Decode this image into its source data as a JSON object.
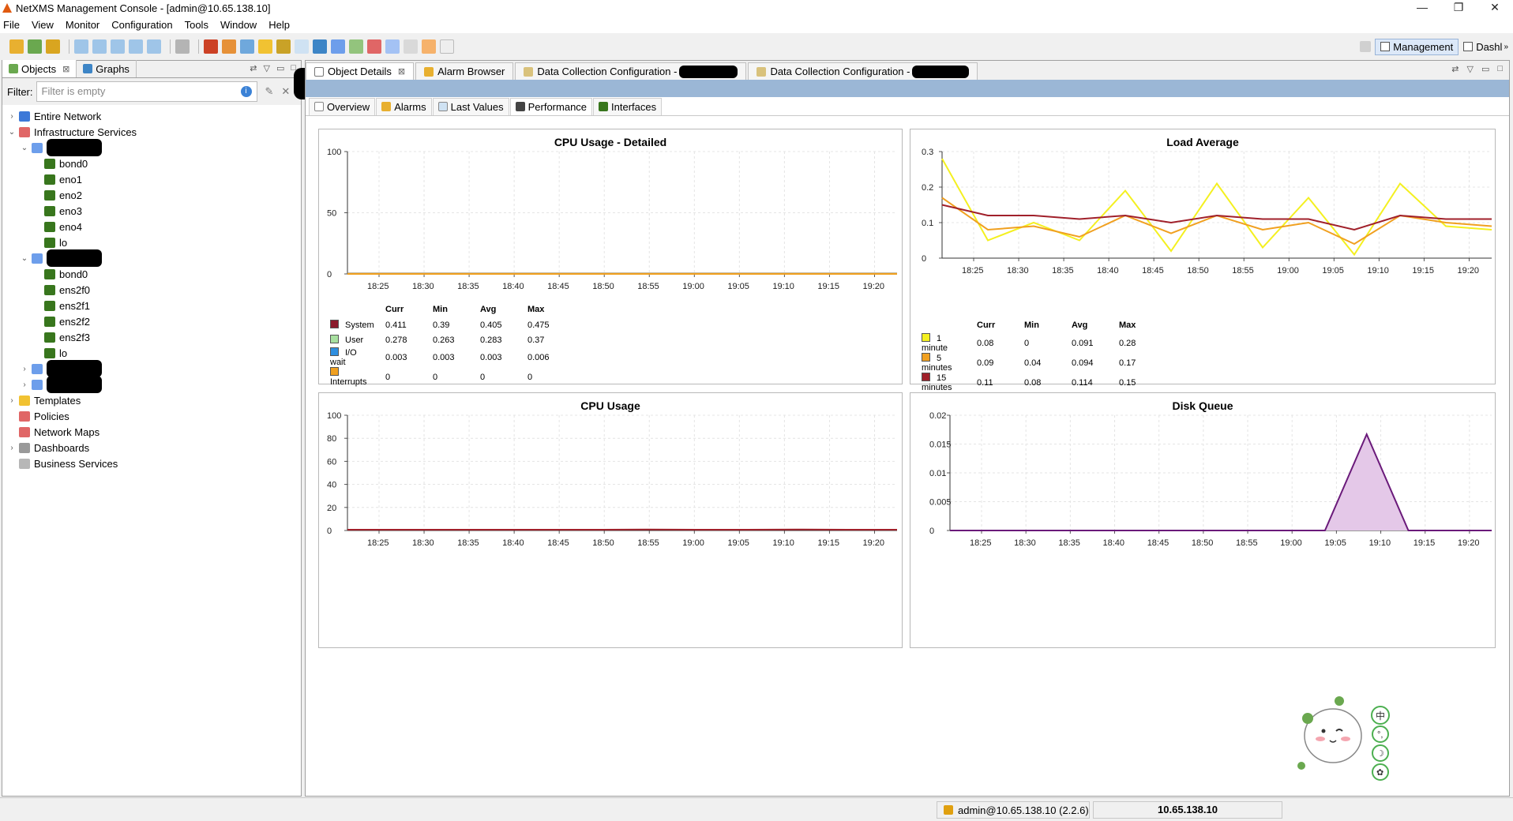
{
  "window": {
    "title": "NetXMS Management Console - [admin@10.65.138.10]",
    "controls": [
      "—",
      "❐",
      "✕"
    ]
  },
  "menu": [
    "File",
    "View",
    "Monitor",
    "Configuration",
    "Tools",
    "Window",
    "Help"
  ],
  "perspectives": [
    "Management",
    "Dashl"
  ],
  "left_panel": {
    "tabs": [
      "Objects",
      "Graphs"
    ],
    "filter_label": "Filter:",
    "filter_placeholder": "Filter is empty",
    "tree": [
      {
        "label": "Entire Network",
        "level": 0,
        "twisty": "›"
      },
      {
        "label": "Infrastructure Services",
        "level": 0,
        "twisty": "⌄"
      },
      {
        "label": "",
        "level": 1,
        "twisty": "⌄",
        "redacted": true
      },
      {
        "label": "bond0",
        "level": 2
      },
      {
        "label": "eno1",
        "level": 2
      },
      {
        "label": "eno2",
        "level": 2
      },
      {
        "label": "eno3",
        "level": 2
      },
      {
        "label": "eno4",
        "level": 2
      },
      {
        "label": "lo",
        "level": 2
      },
      {
        "label": "",
        "level": 1,
        "twisty": "⌄",
        "redacted": true
      },
      {
        "label": "bond0",
        "level": 2
      },
      {
        "label": "ens2f0",
        "level": 2
      },
      {
        "label": "ens2f1",
        "level": 2
      },
      {
        "label": "ens2f2",
        "level": 2
      },
      {
        "label": "ens2f3",
        "level": 2
      },
      {
        "label": "lo",
        "level": 2
      },
      {
        "label": "",
        "level": 1,
        "twisty": "›",
        "redacted": true
      },
      {
        "label": "",
        "level": 1,
        "twisty": "›",
        "redacted": true
      },
      {
        "label": "Templates",
        "level": 0,
        "twisty": "›"
      },
      {
        "label": "Policies",
        "level": 0
      },
      {
        "label": "Network Maps",
        "level": 0
      },
      {
        "label": "Dashboards",
        "level": 0,
        "twisty": "›"
      },
      {
        "label": "Business Services",
        "level": 0
      }
    ]
  },
  "editor_tabs": [
    "Object Details",
    "Alarm Browser",
    "Data Collection Configuration -",
    "Data Collection Configuration -"
  ],
  "sub_tabs": [
    "Overview",
    "Alarms",
    "Last Values",
    "Performance",
    "Interfaces"
  ],
  "time_ticks": [
    "18:25",
    "18:30",
    "18:35",
    "18:40",
    "18:45",
    "18:50",
    "18:55",
    "19:00",
    "19:05",
    "19:10",
    "19:15",
    "19:20"
  ],
  "legend_headers": [
    "Curr",
    "Min",
    "Avg",
    "Max"
  ],
  "charts": {
    "cpu_detailed": {
      "title": "CPU Usage - Detailed",
      "y_ticks": [
        "100",
        "50",
        "0"
      ],
      "legend": [
        {
          "name": "System",
          "color": "#8b1a2b",
          "curr": "0.411",
          "min": "0.39",
          "avg": "0.405",
          "max": "0.475"
        },
        {
          "name": "User",
          "color": "#a8e0a0",
          "curr": "0.278",
          "min": "0.263",
          "avg": "0.283",
          "max": "0.37"
        },
        {
          "name": "I/O wait",
          "color": "#2f8fe0",
          "curr": "0.003",
          "min": "0.003",
          "avg": "0.003",
          "max": "0.006"
        },
        {
          "name": "Interrupts",
          "color": "#f0a020",
          "curr": "0",
          "min": "0",
          "avg": "0",
          "max": "0"
        }
      ]
    },
    "load_average": {
      "title": "Load Average",
      "y_ticks": [
        "0.3",
        "0.2",
        "0.1",
        "0"
      ],
      "legend": [
        {
          "name": "1 minute",
          "color": "#f4f020",
          "curr": "0.08",
          "min": "0",
          "avg": "0.091",
          "max": "0.28"
        },
        {
          "name": "5 minutes",
          "color": "#f0a020",
          "curr": "0.09",
          "min": "0.04",
          "avg": "0.094",
          "max": "0.17"
        },
        {
          "name": "15 minutes",
          "color": "#a0202a",
          "curr": "0.11",
          "min": "0.08",
          "avg": "0.114",
          "max": "0.15"
        }
      ]
    },
    "cpu_usage": {
      "title": "CPU Usage",
      "y_ticks": [
        "100",
        "80",
        "60",
        "40",
        "20",
        "0"
      ]
    },
    "disk_queue": {
      "title": "Disk Queue",
      "y_ticks": [
        "0.02",
        "0.015",
        "0.01",
        "0.005",
        "0"
      ]
    }
  },
  "chart_data": [
    {
      "type": "line",
      "title": "CPU Usage - Detailed",
      "ylim": [
        0,
        100
      ],
      "x": [
        "18:25",
        "18:30",
        "18:35",
        "18:40",
        "18:45",
        "18:50",
        "18:55",
        "19:00",
        "19:05",
        "19:10",
        "19:15",
        "19:20"
      ],
      "series": [
        {
          "name": "System",
          "values": [
            0.41,
            0.41,
            0.4,
            0.41,
            0.4,
            0.41,
            0.4,
            0.41,
            0.41,
            0.4,
            0.41,
            0.41
          ]
        },
        {
          "name": "User",
          "values": [
            0.28,
            0.28,
            0.28,
            0.28,
            0.29,
            0.28,
            0.28,
            0.28,
            0.28,
            0.28,
            0.28,
            0.28
          ]
        },
        {
          "name": "I/O wait",
          "values": [
            0.003,
            0.003,
            0.003,
            0.003,
            0.003,
            0.003,
            0.003,
            0.003,
            0.003,
            0.003,
            0.003,
            0.003
          ]
        },
        {
          "name": "Interrupts",
          "values": [
            0,
            0,
            0,
            0,
            0,
            0,
            0,
            0,
            0,
            0,
            0,
            0
          ]
        }
      ]
    },
    {
      "type": "line",
      "title": "Load Average",
      "ylim": [
        0,
        0.3
      ],
      "x": [
        "18:25",
        "18:30",
        "18:35",
        "18:40",
        "18:45",
        "18:50",
        "18:55",
        "19:00",
        "19:05",
        "19:10",
        "19:15",
        "19:20"
      ],
      "series": [
        {
          "name": "1 minute",
          "values": [
            0.28,
            0.05,
            0.1,
            0.05,
            0.19,
            0.02,
            0.21,
            0.03,
            0.17,
            0.01,
            0.21,
            0.09,
            0.08
          ]
        },
        {
          "name": "5 minutes",
          "values": [
            0.17,
            0.08,
            0.09,
            0.06,
            0.12,
            0.07,
            0.12,
            0.08,
            0.1,
            0.04,
            0.12,
            0.1,
            0.09
          ]
        },
        {
          "name": "15 minutes",
          "values": [
            0.15,
            0.12,
            0.12,
            0.11,
            0.12,
            0.1,
            0.12,
            0.11,
            0.11,
            0.08,
            0.12,
            0.11,
            0.11
          ]
        }
      ]
    },
    {
      "type": "line",
      "title": "CPU Usage",
      "ylim": [
        0,
        100
      ],
      "x": [
        "18:25",
        "18:30",
        "18:35",
        "18:40",
        "18:45",
        "18:50",
        "18:55",
        "19:00",
        "19:05",
        "19:10",
        "19:15",
        "19:20"
      ],
      "series": [
        {
          "values": [
            0.7,
            0.7,
            0.7,
            0.7,
            0.7,
            0.7,
            0.9,
            0.7,
            0.7,
            0.9,
            0.7,
            0.7
          ]
        }
      ]
    },
    {
      "type": "area",
      "title": "Disk Queue",
      "ylim": [
        0,
        0.02
      ],
      "x": [
        "18:25",
        "18:30",
        "18:35",
        "18:40",
        "18:45",
        "18:50",
        "18:55",
        "19:00",
        "19:05",
        "19:08",
        "19:09",
        "19:10",
        "19:15",
        "19:20"
      ],
      "series": [
        {
          "values": [
            0,
            0,
            0,
            0,
            0,
            0,
            0,
            0,
            0,
            0,
            0.0167,
            0,
            0,
            0
          ]
        }
      ]
    }
  ],
  "status": {
    "user": "admin@10.65.138.10 (2.2.6)",
    "host": "10.65.138.10"
  }
}
